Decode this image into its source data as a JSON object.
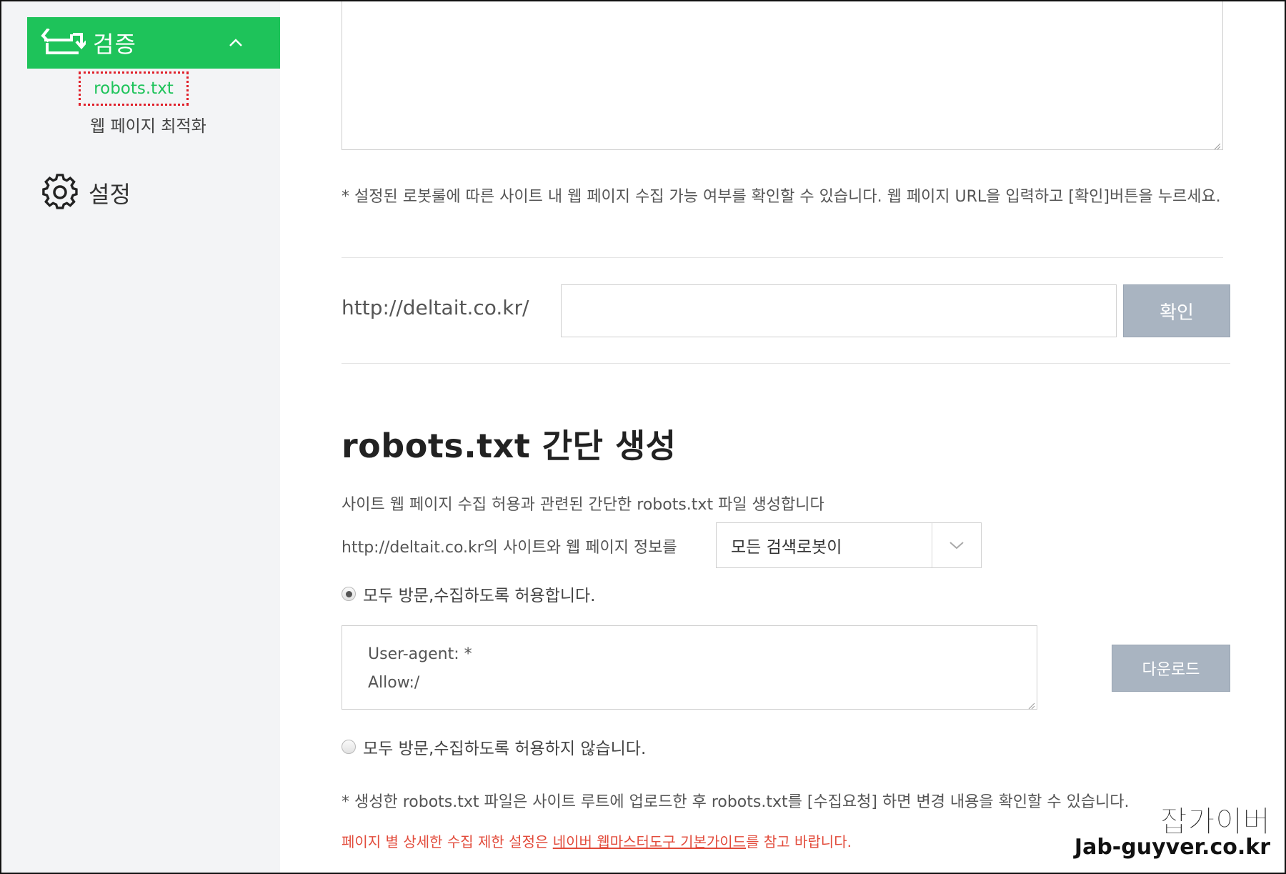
{
  "sidebar": {
    "verify": {
      "label": "검증",
      "icon": "refresh-arrows-icon",
      "expanded": true
    },
    "sub_items": [
      {
        "label": "robots.txt",
        "active": true
      },
      {
        "label": "웹 페이지 최적화",
        "active": false
      }
    ],
    "settings": {
      "label": "설정",
      "icon": "gear-icon"
    }
  },
  "main": {
    "check": {
      "note": "* 설정된 로봇룰에 따른 사이트 내 웹 페이지 수집 가능 여부를 확인할 수 있습니다. 웹 페이지 URL을 입력하고 [확인]버튼을 누르세요.",
      "url_prefix": "http://deltait.co.kr/",
      "url_value": "",
      "confirm_label": "확인"
    },
    "generate": {
      "title": "robots.txt 간단 생성",
      "description": "사이트 웹 페이지 수집 허용과 관련된 간단한 robots.txt 파일 생성합니다",
      "info_text": "http://deltait.co.kr의 사이트와 웹 페이지 정보를",
      "select_value": "모든 검색로봇이",
      "radio_allow": "모두 방문,수집하도록 허용합니다.",
      "radio_deny": "모두 방문,수집하도록 허용하지 않습니다.",
      "selected_option": "allow",
      "robots_lines": [
        "User-agent: *",
        "Allow:/"
      ],
      "download_label": "다운로드",
      "note_upload": "* 생성한 robots.txt 파일은 사이트 루트에 업로드한 후 robots.txt를 [수집요청] 하면 변경 내용을 확인할 수 있습니다.",
      "note_detail_prefix": "페이지 별 상세한 수집 제한 설정은 ",
      "note_detail_link": "네이버 웹마스터도구 기본가이드",
      "note_detail_suffix": "를 참고 바랍니다."
    }
  },
  "watermark": {
    "line1": "잡가이버",
    "line2": "Jab-guyver.co.kr"
  },
  "colors": {
    "accent": "#1ec35a",
    "button_disabled": "#a9b4c1",
    "warning_text": "#e24b3b",
    "highlight_border": "#e0202a"
  }
}
